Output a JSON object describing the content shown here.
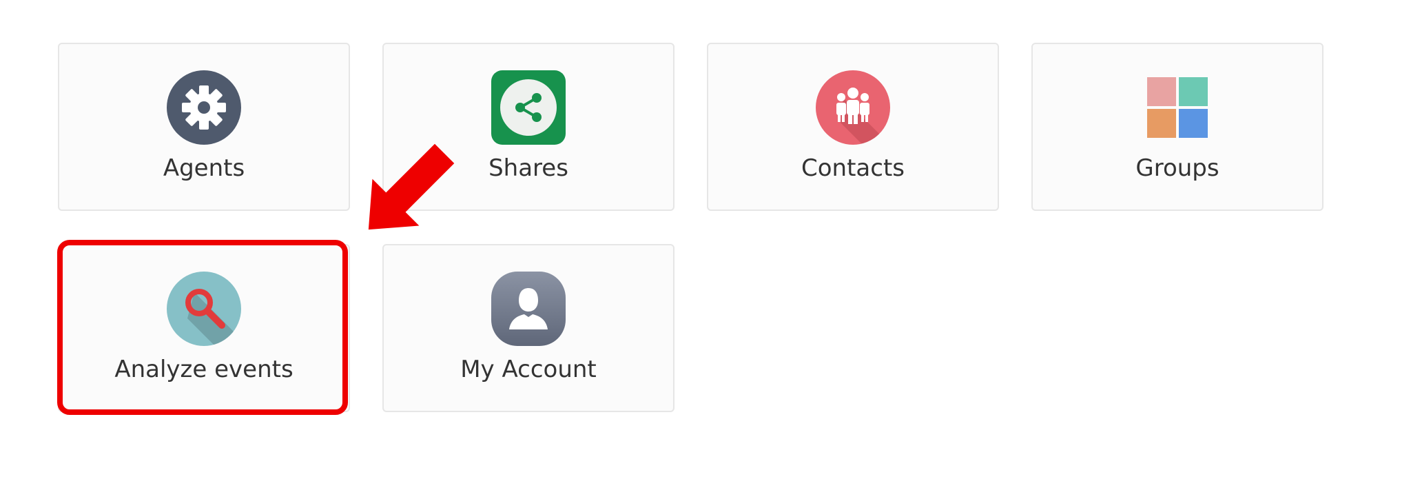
{
  "tiles": [
    {
      "label": "Agents",
      "icon": "gear-icon",
      "color": "#4f5a6d"
    },
    {
      "label": "Shares",
      "icon": "share-icon",
      "color": "#17924d"
    },
    {
      "label": "Contacts",
      "icon": "people-icon",
      "color": "#e96470"
    },
    {
      "label": "Groups",
      "icon": "grid-icon",
      "colors": [
        "#e8a3a2",
        "#6cc9b3",
        "#e79b63",
        "#5b95e3"
      ]
    },
    {
      "label": "Analyze events",
      "icon": "magnifier-icon",
      "color": "#86c0c7"
    },
    {
      "label": "My Account",
      "icon": "user-profile-icon",
      "color": "#6f7789"
    }
  ],
  "annotation": {
    "highlight_color": "#ee0000",
    "highlighted_tile": "Analyze events",
    "arrow_icon": "pointer-arrow-icon"
  }
}
